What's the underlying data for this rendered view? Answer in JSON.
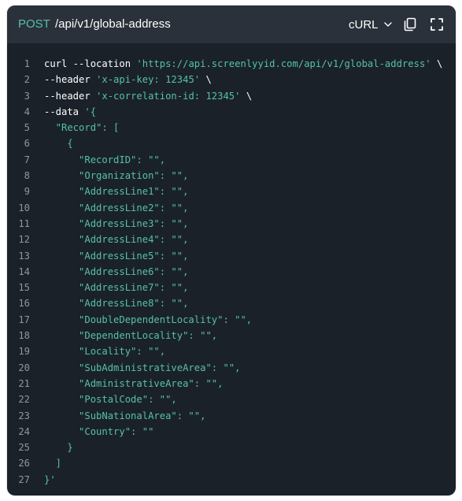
{
  "header": {
    "method": "POST",
    "endpoint": "/api/v1/global-address",
    "language": "cURL"
  },
  "icons": {
    "language_chevron": "chevron-down-icon",
    "copy": "copy-icon",
    "expand": "fullscreen-icon"
  },
  "colors": {
    "panel_background": "#1b2129",
    "header_background": "#2a313a",
    "accent_green": "#54c2a6",
    "line_number": "#8c96a3",
    "text": "#ffffff"
  },
  "code": {
    "lines": [
      {
        "n": "1",
        "segments": [
          {
            "t": "curl --location ",
            "c": "plain"
          },
          {
            "t": "'https://api.screenlyyid.com/api/v1/global-address'",
            "c": "str"
          },
          {
            "t": " \\",
            "c": "plain"
          }
        ]
      },
      {
        "n": "2",
        "segments": [
          {
            "t": "--header ",
            "c": "plain"
          },
          {
            "t": "'x-api-key: 12345'",
            "c": "str"
          },
          {
            "t": " \\",
            "c": "plain"
          }
        ]
      },
      {
        "n": "3",
        "segments": [
          {
            "t": "--header ",
            "c": "plain"
          },
          {
            "t": "'x-correlation-id: 12345'",
            "c": "str"
          },
          {
            "t": " \\",
            "c": "plain"
          }
        ]
      },
      {
        "n": "4",
        "segments": [
          {
            "t": "--data ",
            "c": "plain"
          },
          {
            "t": "'{",
            "c": "str"
          }
        ]
      },
      {
        "n": "5",
        "segments": [
          {
            "t": "  \"Record\": [",
            "c": "str"
          }
        ]
      },
      {
        "n": "6",
        "segments": [
          {
            "t": "    {",
            "c": "str"
          }
        ]
      },
      {
        "n": "7",
        "segments": [
          {
            "t": "      \"RecordID\": \"\",",
            "c": "str"
          }
        ]
      },
      {
        "n": "8",
        "segments": [
          {
            "t": "      \"Organization\": \"\",",
            "c": "str"
          }
        ]
      },
      {
        "n": "9",
        "segments": [
          {
            "t": "      \"AddressLine1\": \"\",",
            "c": "str"
          }
        ]
      },
      {
        "n": "10",
        "segments": [
          {
            "t": "      \"AddressLine2\": \"\",",
            "c": "str"
          }
        ]
      },
      {
        "n": "11",
        "segments": [
          {
            "t": "      \"AddressLine3\": \"\",",
            "c": "str"
          }
        ]
      },
      {
        "n": "12",
        "segments": [
          {
            "t": "      \"AddressLine4\": \"\",",
            "c": "str"
          }
        ]
      },
      {
        "n": "13",
        "segments": [
          {
            "t": "      \"AddressLine5\": \"\",",
            "c": "str"
          }
        ]
      },
      {
        "n": "14",
        "segments": [
          {
            "t": "      \"AddressLine6\": \"\",",
            "c": "str"
          }
        ]
      },
      {
        "n": "15",
        "segments": [
          {
            "t": "      \"AddressLine7\": \"\",",
            "c": "str"
          }
        ]
      },
      {
        "n": "16",
        "segments": [
          {
            "t": "      \"AddressLine8\": \"\",",
            "c": "str"
          }
        ]
      },
      {
        "n": "17",
        "segments": [
          {
            "t": "      \"DoubleDependentLocality\": \"\",",
            "c": "str"
          }
        ]
      },
      {
        "n": "18",
        "segments": [
          {
            "t": "      \"DependentLocality\": \"\",",
            "c": "str"
          }
        ]
      },
      {
        "n": "19",
        "segments": [
          {
            "t": "      \"Locality\": \"\",",
            "c": "str"
          }
        ]
      },
      {
        "n": "20",
        "segments": [
          {
            "t": "      \"SubAdministrativeArea\": \"\",",
            "c": "str"
          }
        ]
      },
      {
        "n": "21",
        "segments": [
          {
            "t": "      \"AdministrativeArea\": \"\",",
            "c": "str"
          }
        ]
      },
      {
        "n": "22",
        "segments": [
          {
            "t": "      \"PostalCode\": \"\",",
            "c": "str"
          }
        ]
      },
      {
        "n": "23",
        "segments": [
          {
            "t": "      \"SubNationalArea\": \"\",",
            "c": "str"
          }
        ]
      },
      {
        "n": "24",
        "segments": [
          {
            "t": "      \"Country\": \"\"",
            "c": "str"
          }
        ]
      },
      {
        "n": "25",
        "segments": [
          {
            "t": "    }",
            "c": "str"
          }
        ]
      },
      {
        "n": "26",
        "segments": [
          {
            "t": "  ]",
            "c": "str"
          }
        ]
      },
      {
        "n": "27",
        "segments": [
          {
            "t": "}'",
            "c": "str"
          }
        ]
      }
    ]
  }
}
